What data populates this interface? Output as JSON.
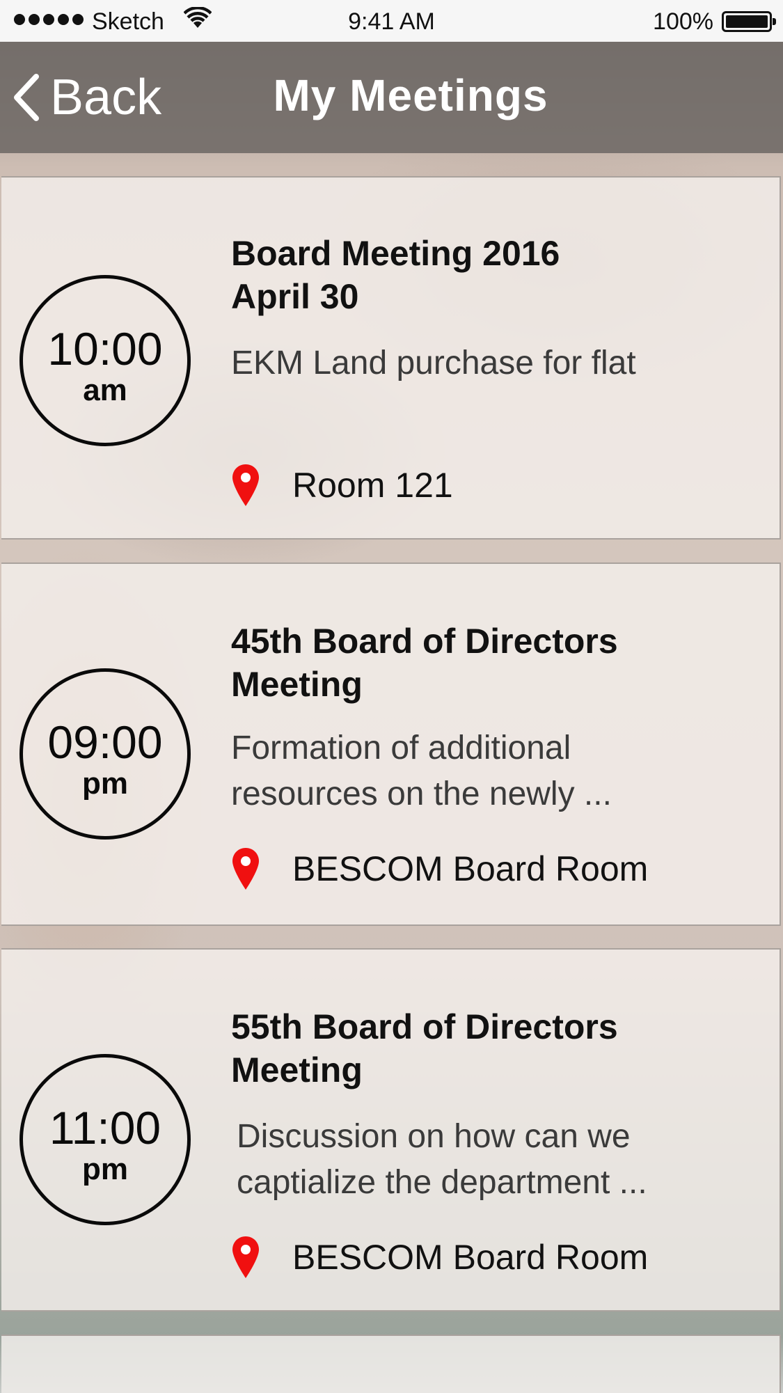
{
  "status_bar": {
    "carrier": "Sketch",
    "time": "9:41 AM",
    "battery": "100%"
  },
  "nav": {
    "back_label": "Back",
    "title": "My Meetings"
  },
  "meetings": [
    {
      "time": "10:00",
      "ampm": "am",
      "title": "Board Meeting 2016\nApril 30",
      "description": "EKM Land purchase for flat",
      "location": "Room 121"
    },
    {
      "time": "09:00",
      "ampm": "pm",
      "title": "45th Board of Directors\nMeeting",
      "description": "Formation of additional\nresources on the newly ...",
      "location": "BESCOM Board Room"
    },
    {
      "time": "11:00",
      "ampm": "pm",
      "title": "55th Board of Directors\nMeeting",
      "description": "Discussion on how can we\ncaptialize the department ...",
      "location": "BESCOM Board Room"
    }
  ],
  "colors": {
    "pin": "#f01010",
    "nav_bg": "#6e6965"
  },
  "icons": {
    "back": "chevron-left-icon",
    "location": "map-pin-icon",
    "wifi": "wifi-icon",
    "battery": "battery-icon"
  }
}
